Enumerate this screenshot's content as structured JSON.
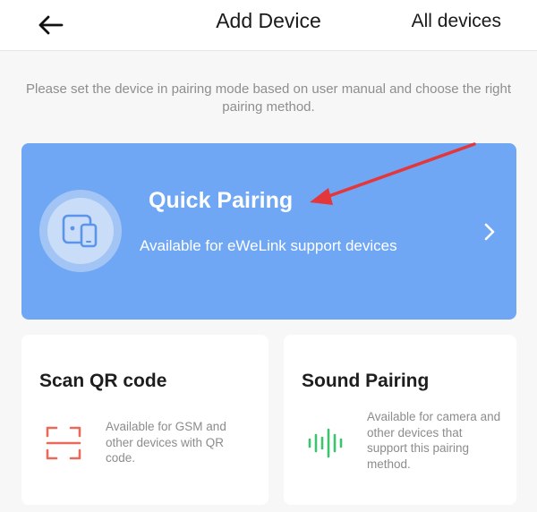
{
  "header": {
    "title": "Add Device",
    "back_icon": "arrow-left-icon",
    "all_devices_label": "All devices"
  },
  "instructions": "Please set the device in pairing mode based on user manual and choose the right pairing method.",
  "quick_pairing": {
    "title": "Quick Pairing",
    "description": "Available for eWeLink support devices",
    "icon": "device-phone-icon",
    "chevron_icon": "chevron-right-icon",
    "background_color": "#6fa7f4"
  },
  "methods": [
    {
      "title": "Scan QR code",
      "description": "Available for GSM and other devices with QR code.",
      "icon": "qr-scan-icon",
      "icon_color": "#e86a5b"
    },
    {
      "title": "Sound Pairing",
      "description": "Available for camera and other devices that support this pairing method.",
      "icon": "sound-wave-icon",
      "icon_color": "#3bc46d"
    }
  ],
  "annotation": {
    "arrow_color": "#e3373c"
  }
}
